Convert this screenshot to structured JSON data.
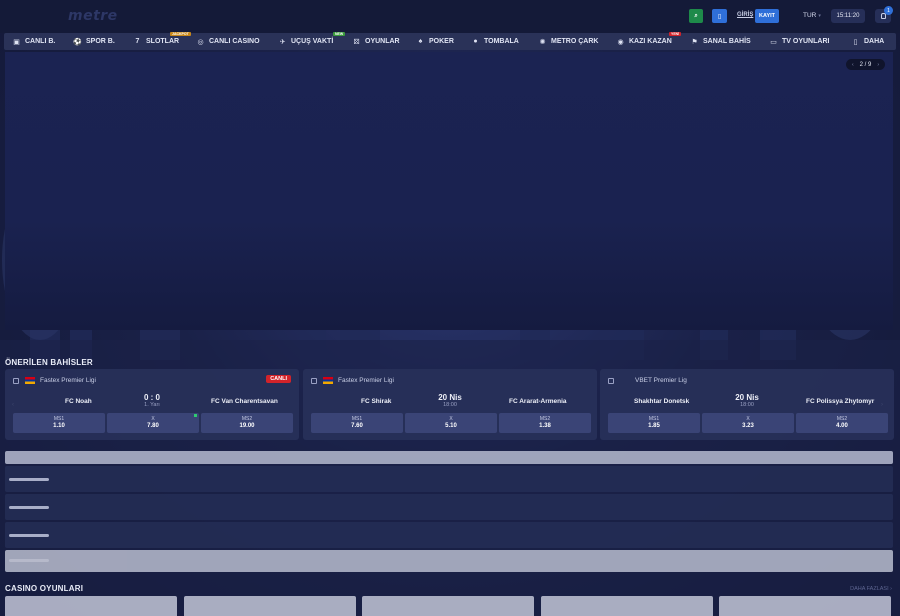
{
  "header": {
    "logo": "metre",
    "login": "GİRİŞ",
    "register": "KAYIT",
    "language": "TUR",
    "clock": "15:11:20",
    "notifications_count": "1"
  },
  "nav": [
    {
      "label": "CANLI B.",
      "icon": "live-icon"
    },
    {
      "label": "SPOR B.",
      "icon": "ball-icon"
    },
    {
      "label": "SLOTLAR",
      "icon": "seven-icon",
      "tag": "JACKPOT"
    },
    {
      "label": "CANLI CASINO",
      "icon": "chip-icon"
    },
    {
      "label": "UÇUŞ VAKTİ",
      "icon": "plane-icon",
      "tag": "NEW"
    },
    {
      "label": "OYUNLAR",
      "icon": "dice-icon"
    },
    {
      "label": "POKER",
      "icon": "spade-icon"
    },
    {
      "label": "TOMBALA",
      "icon": "ball-icon"
    },
    {
      "label": "METRO ÇARK",
      "icon": "wheel-icon"
    },
    {
      "label": "KAZI KAZAN",
      "icon": "scratch-icon",
      "tag": "YENİ"
    },
    {
      "label": "SANAL BAHİS",
      "icon": "virtual-icon"
    },
    {
      "label": "TV OYUNLARI",
      "icon": "tv-icon"
    },
    {
      "label": "DAHA",
      "icon": "more-icon"
    }
  ],
  "hero": {
    "slide_counter": "2 / 9"
  },
  "recommended": {
    "title": "ÖNERİLEN BAHİSLER",
    "cards": [
      {
        "league": "Fastex Premier Ligi",
        "live": "CANLI",
        "home": "FC Noah",
        "away": "FC Van Charentsavan",
        "center_main": "0 : 0",
        "center_sub": "1. Yarı",
        "odds": [
          {
            "label": "MS1",
            "value": "1.10"
          },
          {
            "label": "X",
            "value": "7.80"
          },
          {
            "label": "MS2",
            "value": "19.00"
          }
        ]
      },
      {
        "league": "Fastex Premier Ligi",
        "live": "",
        "home": "FC Shirak",
        "away": "FC Ararat-Armenia",
        "center_main": "20 Nis",
        "center_sub": "18:00",
        "odds": [
          {
            "label": "MS1",
            "value": "7.60"
          },
          {
            "label": "X",
            "value": "5.10"
          },
          {
            "label": "MS2",
            "value": "1.38"
          }
        ]
      },
      {
        "league": "VBET Premier Lig",
        "live": "",
        "home": "Shakhtar Donetsk",
        "away": "FC Polissya Zhytomyr",
        "center_main": "20 Nis",
        "center_sub": "18:00",
        "odds": [
          {
            "label": "MS1",
            "value": "1.85"
          },
          {
            "label": "X",
            "value": "3.23"
          },
          {
            "label": "MS2",
            "value": "4.00"
          }
        ]
      }
    ]
  },
  "casino": {
    "title": "CASINO OYUNLARI",
    "see_all": "DAHA FAZLASI"
  }
}
